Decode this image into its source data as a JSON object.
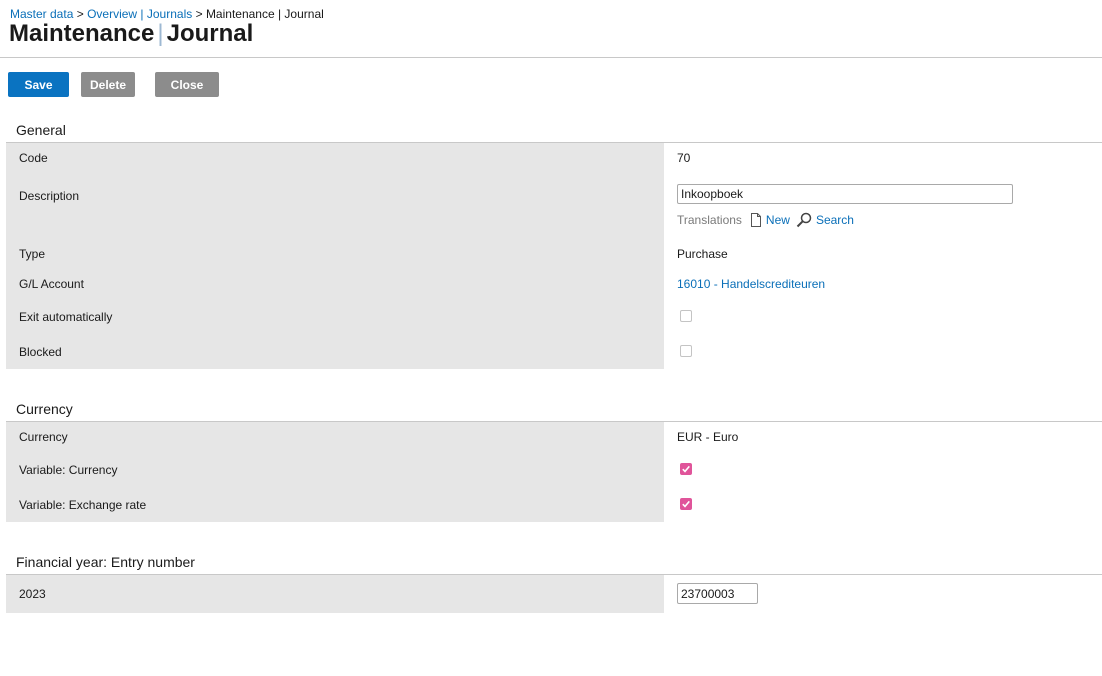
{
  "breadcrumb": {
    "items": [
      "Master data",
      "Overview | Journals",
      "Maintenance | Journal"
    ],
    "separator": ">"
  },
  "page_title": {
    "part1": "Maintenance",
    "divider": "|",
    "part2": "Journal"
  },
  "toolbar": {
    "save_label": "Save",
    "delete_label": "Delete",
    "close_label": "Close"
  },
  "sections": {
    "general": {
      "title": "General",
      "code_label": "Code",
      "code_value": "70",
      "description_label": "Description",
      "description_value": "Inkoopboek",
      "translations_label": "Translations",
      "translations_new": "New",
      "translations_search": "Search",
      "type_label": "Type",
      "type_value": "Purchase",
      "gl_label": "G/L Account",
      "gl_value": "16010 - Handelscrediteuren",
      "exit_label": "Exit automatically",
      "exit_checked": false,
      "blocked_label": "Blocked",
      "blocked_checked": false
    },
    "currency": {
      "title": "Currency",
      "currency_label": "Currency",
      "currency_value": "EUR - Euro",
      "var_currency_label": "Variable: Currency",
      "var_currency_checked": true,
      "var_rate_label": "Variable: Exchange rate",
      "var_rate_checked": true
    },
    "financial_year": {
      "title": "Financial year: Entry number",
      "year_label": "2023",
      "entry_value": "23700003"
    }
  },
  "colors": {
    "link": "#0a6fb8",
    "primary_button": "#0a73c1",
    "secondary_button": "#8c8c8c",
    "label_background": "#e6e6e6",
    "checkbox_checked": "#e0549a"
  }
}
